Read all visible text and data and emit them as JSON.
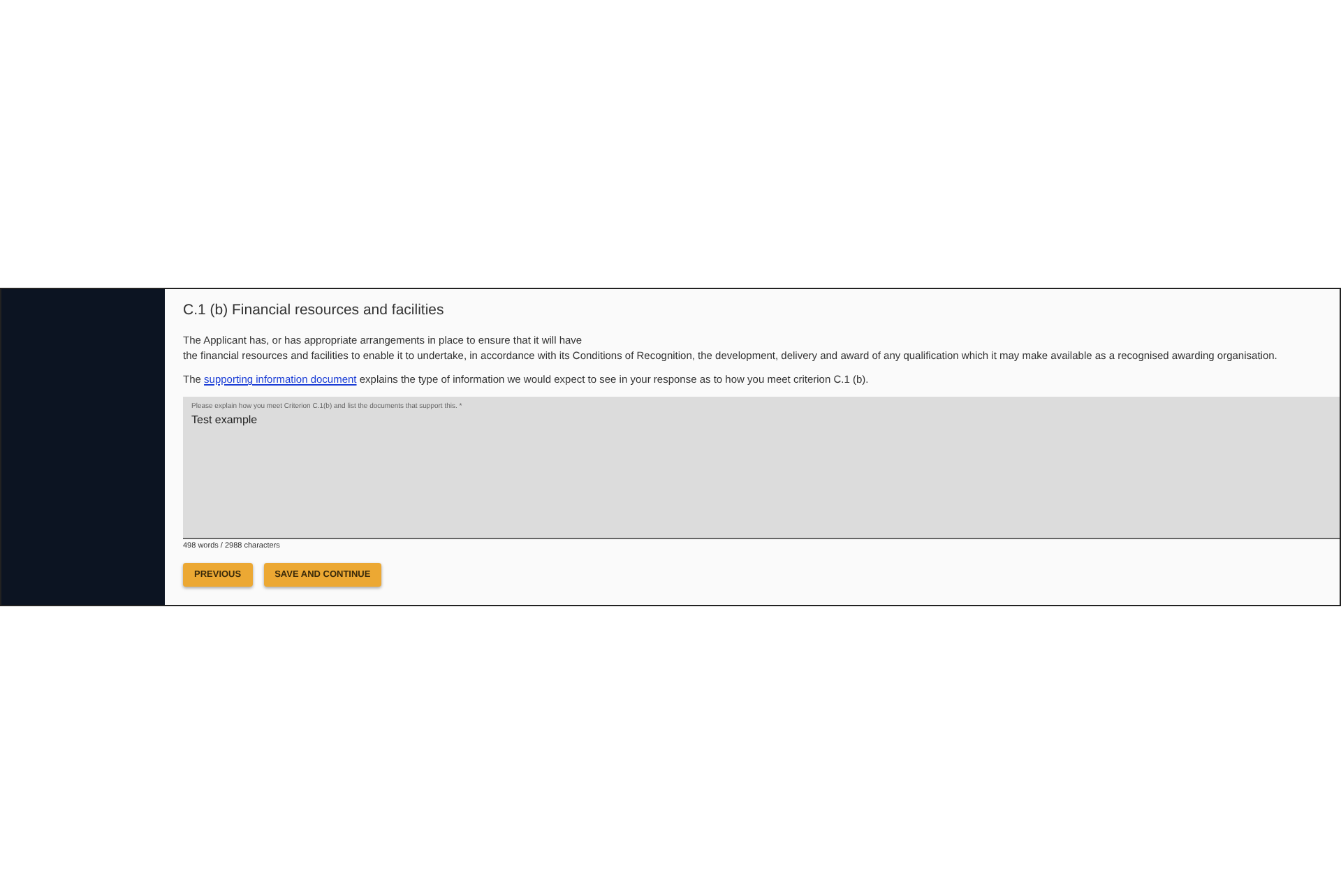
{
  "section": {
    "title": "C.1 (b) Financial resources and facilities",
    "intro_lines": [
      "The Applicant has, or has appropriate arrangements in place to ensure that it will have",
      "the financial resources and facilities to enable it to undertake, in accordance with its Conditions of Recognition, the development, delivery and award of any qualification which it may make available as a recognised awarding organisation."
    ],
    "guidance": {
      "before": "The",
      "link": "supporting information document",
      "after": "explains the type of information we would expect to see in your response as to how you meet criterion C.1 (b)."
    }
  },
  "response_field": {
    "label": "Please explain how you meet Criterion C.1(b) and list the documents that support this. *",
    "value": "Test example",
    "counter": "498 words / 2988 characters"
  },
  "buttons": [
    "PREVIOUS",
    "SAVE AND CONTINUE"
  ]
}
